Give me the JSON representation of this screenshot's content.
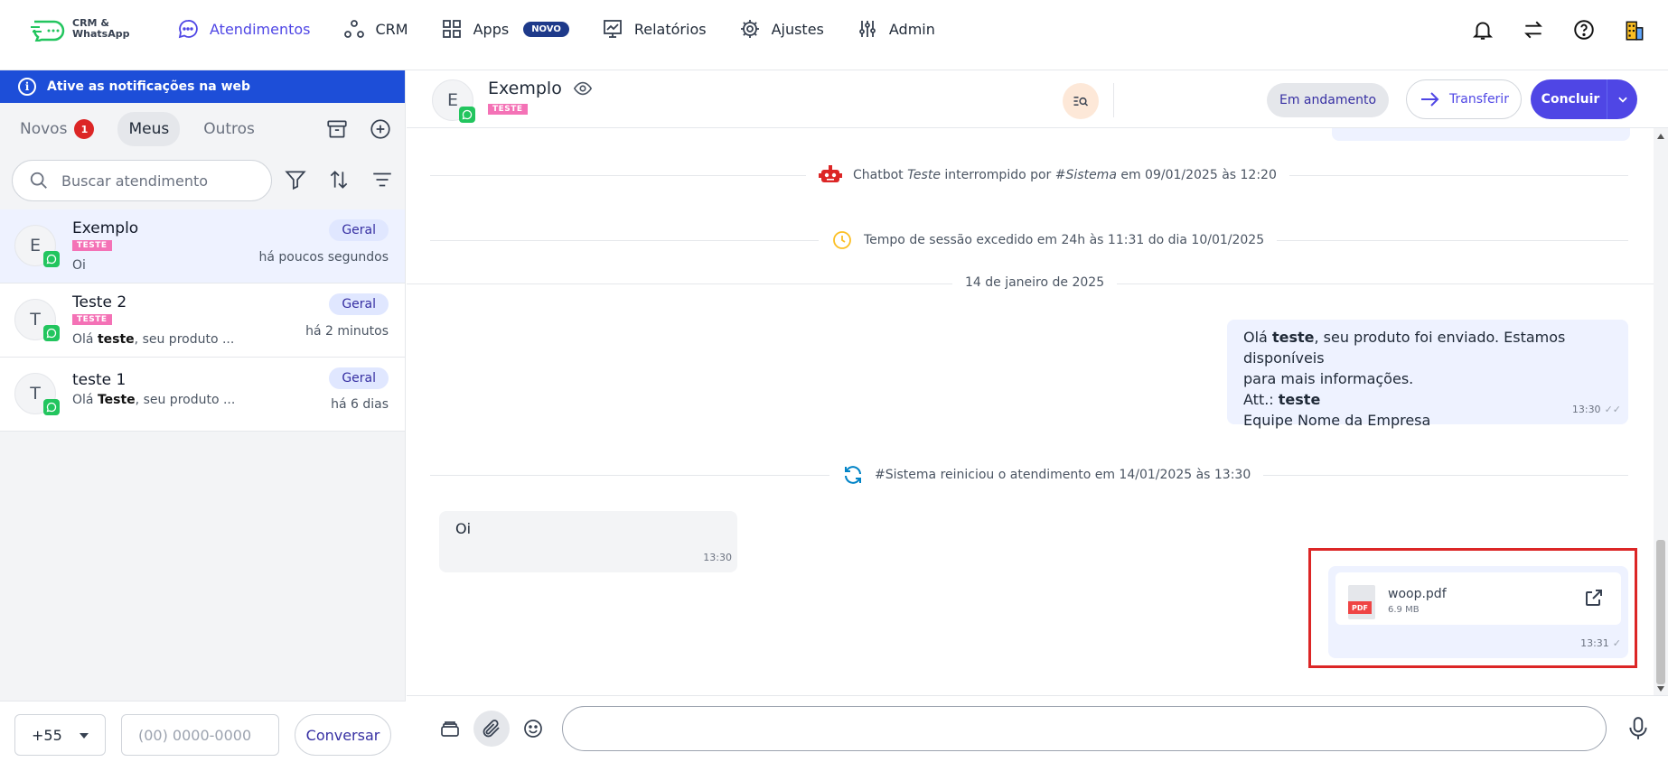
{
  "app": {
    "logo_line1": "CRM &",
    "logo_line2": "WhatsApp"
  },
  "nav": {
    "items": [
      {
        "label": "Atendimentos",
        "icon": "chat-bubble-icon",
        "active": true
      },
      {
        "label": "CRM",
        "icon": "network-icon"
      },
      {
        "label": "Apps",
        "icon": "grid-icon",
        "badge": "NOVO"
      },
      {
        "label": "Relatórios",
        "icon": "chart-icon"
      },
      {
        "label": "Ajustes",
        "icon": "gear-icon"
      },
      {
        "label": "Admin",
        "icon": "sliders-icon"
      }
    ]
  },
  "sidebar": {
    "notification_banner": "Ative as notificações na web",
    "tabs": [
      {
        "label": "Novos",
        "count": "1"
      },
      {
        "label": "Meus",
        "active": true
      },
      {
        "label": "Outros"
      }
    ],
    "search_placeholder": "Buscar atendimento",
    "conversations": [
      {
        "initial": "E",
        "name": "Exemplo",
        "tag": "TESTE",
        "preview": "Oi",
        "queue": "Geral",
        "time": "há poucos segundos",
        "active": true
      },
      {
        "initial": "T",
        "name": "Teste 2",
        "tag": "TESTE",
        "preview_prefix": "Olá ",
        "preview_bold": "teste",
        "preview_suffix": ", seu produto ...",
        "queue": "Geral",
        "time": "há 2 minutos"
      },
      {
        "initial": "T",
        "name": "teste 1",
        "preview_prefix": "Olá ",
        "preview_bold": "Teste",
        "preview_suffix": ", seu produto ...",
        "queue": "Geral",
        "time": "há 6 dias"
      }
    ],
    "country_code": "+55",
    "phone_placeholder": "(00) 0000-0000",
    "conversar_label": "Conversar"
  },
  "chat": {
    "contact_initial": "E",
    "contact_name": "Exemplo",
    "contact_tag": "TESTE",
    "status": "Em andamento",
    "transfer_label": "Transferir",
    "conclude_label": "Concluir",
    "system_messages": {
      "chatbot_prefix": "Chatbot ",
      "chatbot_name": "Teste",
      "chatbot_mid": " interrompido por ",
      "chatbot_by": "#Sistema",
      "chatbot_suffix": " em 09/01/2025 às 12:20",
      "session_expired": "Tempo de sessão excedido em 24h às 11:31 do dia 10/01/2025",
      "restarted": "#Sistema reiniciou o atendimento em 14/01/2025 às 13:30"
    },
    "date_separator": "14 de janeiro de 2025",
    "outgoing_message": {
      "line1_prefix": "Olá ",
      "line1_bold": "teste",
      "line1_suffix": ", seu produto foi enviado. Estamos disponíveis",
      "line2": "para mais informações.",
      "line3_prefix": "Att.: ",
      "line3_bold": "teste",
      "line4": "Equipe Nome da Empresa",
      "time": "13:30"
    },
    "incoming_message": {
      "text": "Oi",
      "time": "13:30"
    },
    "file_message": {
      "file_type": "PDF",
      "file_name": "woop.pdf",
      "file_size": "6.9 MB",
      "time": "13:31"
    }
  }
}
